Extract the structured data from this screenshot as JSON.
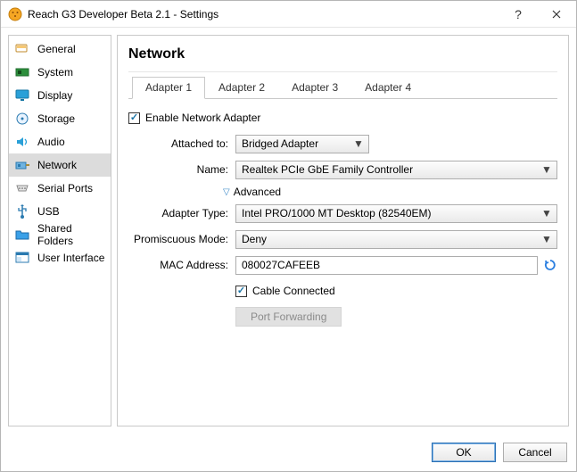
{
  "window": {
    "title": "Reach G3 Developer Beta 2.1 - Settings"
  },
  "sidebar": {
    "items": [
      {
        "id": "general",
        "label": "General"
      },
      {
        "id": "system",
        "label": "System"
      },
      {
        "id": "display",
        "label": "Display"
      },
      {
        "id": "storage",
        "label": "Storage"
      },
      {
        "id": "audio",
        "label": "Audio"
      },
      {
        "id": "network",
        "label": "Network",
        "selected": true
      },
      {
        "id": "serialports",
        "label": "Serial Ports"
      },
      {
        "id": "usb",
        "label": "USB"
      },
      {
        "id": "sharedfolders",
        "label": "Shared Folders"
      },
      {
        "id": "userinterface",
        "label": "User Interface"
      }
    ]
  },
  "page": {
    "title": "Network"
  },
  "tabs": [
    {
      "label": "Adapter 1",
      "active": true
    },
    {
      "label": "Adapter 2"
    },
    {
      "label": "Adapter 3"
    },
    {
      "label": "Adapter 4"
    }
  ],
  "form": {
    "enable_label": "Enable Network Adapter",
    "enable_checked": true,
    "attached_label": "Attached to:",
    "attached_value": "Bridged Adapter",
    "name_label": "Name:",
    "name_value": "Realtek PCIe GbE Family Controller",
    "advanced_label": "Advanced",
    "adapter_type_label": "Adapter Type:",
    "adapter_type_value": "Intel PRO/1000 MT Desktop (82540EM)",
    "promiscuous_label": "Promiscuous Mode:",
    "promiscuous_value": "Deny",
    "mac_label": "MAC Address:",
    "mac_value": "080027CAFEEB",
    "cable_label": "Cable Connected",
    "cable_checked": true,
    "port_fwd_label": "Port Forwarding"
  },
  "footer": {
    "ok": "OK",
    "cancel": "Cancel"
  }
}
